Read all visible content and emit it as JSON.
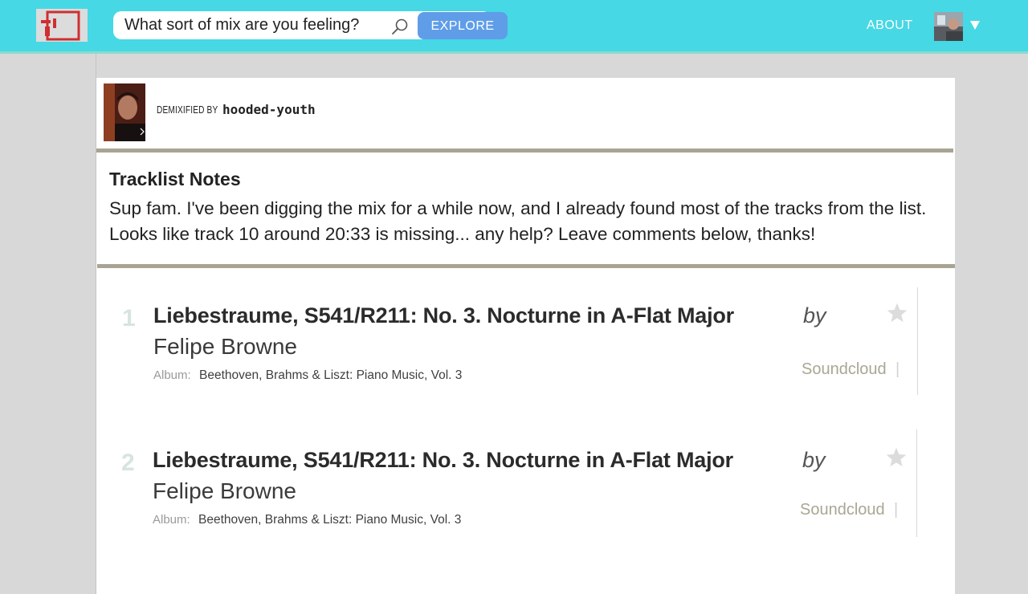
{
  "header": {
    "search_placeholder": "What sort of mix are you feeling?",
    "explore_label": "EXPLORE",
    "about_label": "ABOUT",
    "colors": {
      "bar": "#46d8e5",
      "explore": "#5f9de8"
    }
  },
  "author": {
    "prefix": "DEMIXIFIED BY",
    "username": "hooded-youth"
  },
  "notes": {
    "title": "Tracklist Notes",
    "body": "Sup fam. I've been digging the mix for a while now, and I already found most of the tracks from the list. Looks like track 10 around 20:33 is missing... any help? Leave comments below, thanks!"
  },
  "tracks": [
    {
      "number": "1",
      "title": "Liebestraume, S541/R211: No. 3. Nocturne in A-Flat Major",
      "by": "by",
      "artist": "Felipe Browne",
      "album_label": "Album:",
      "album": "Beethoven, Brahms & Liszt: Piano Music, Vol. 3",
      "source": "Soundcloud",
      "separator": "|"
    },
    {
      "number": "2",
      "title": "Liebestraume, S541/R211: No. 3. Nocturne in A-Flat Major",
      "by": "by",
      "artist": "Felipe Browne",
      "album_label": "Album:",
      "album": "Beethoven, Brahms & Liszt: Piano Music, Vol. 3",
      "source": "Soundcloud",
      "separator": "|"
    }
  ]
}
